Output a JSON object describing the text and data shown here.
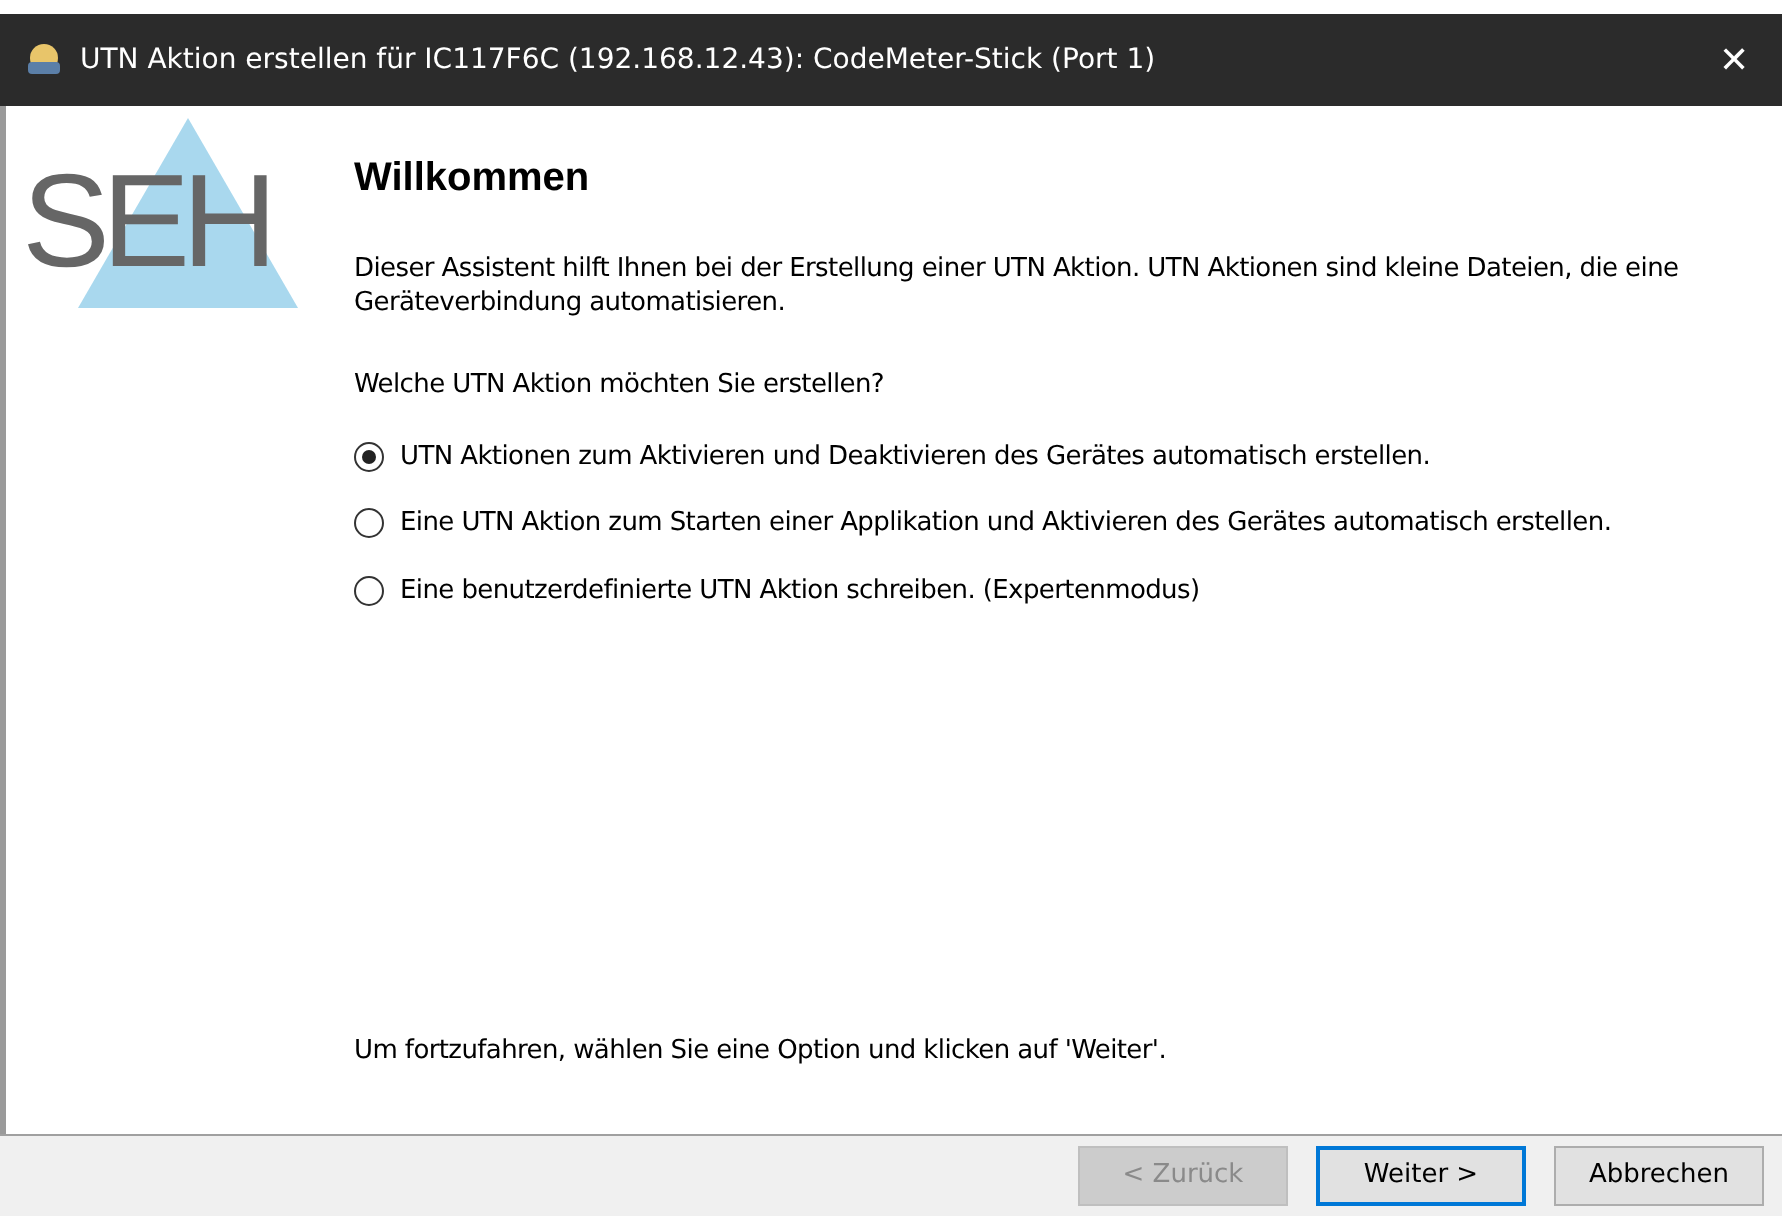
{
  "window": {
    "title": "UTN Aktion erstellen für IC117F6C (192.168.12.43): CodeMeter-Stick (Port 1)",
    "close": "✕"
  },
  "logo": {
    "text": "SEH"
  },
  "heading": "Willkommen",
  "description": "Dieser Assistent hilft Ihnen bei der Erstellung einer UTN Aktion. UTN Aktionen sind kleine Dateien, die eine Geräteverbindung automatisieren.",
  "question": "Welche UTN Aktion möchten Sie erstellen?",
  "options": [
    {
      "label": "UTN Aktionen zum Aktivieren und Deaktivieren des Gerätes automatisch erstellen.",
      "selected": true
    },
    {
      "label": "Eine UTN Aktion zum Starten einer Applikation und Aktivieren des Gerätes automatisch erstellen.",
      "selected": false
    },
    {
      "label": "Eine benutzerdefinierte UTN Aktion schreiben. (Expertenmodus)",
      "selected": false
    }
  ],
  "hint": "Um fortzufahren, wählen Sie eine Option und klicken auf 'Weiter'.",
  "buttons": [
    {
      "label": "< Zurück",
      "disabled": true,
      "default": false
    },
    {
      "label": "Weiter >",
      "disabled": false,
      "default": true
    },
    {
      "label": "Abbrechen",
      "disabled": false,
      "default": false
    }
  ]
}
